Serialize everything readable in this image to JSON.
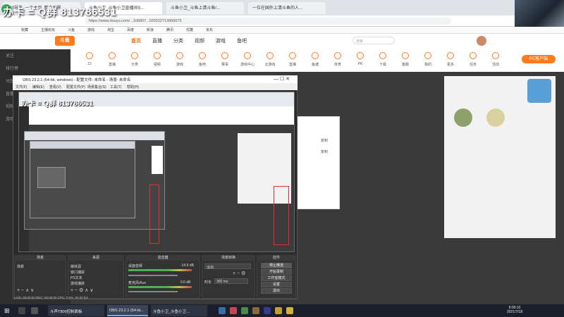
{
  "overlay": {
    "text": "办卡 = Q群 813786531",
    "small_text": "办卡 = Q群 813786531"
  },
  "browser": {
    "tabs": [
      "360导航_一个主页, 整个世界",
      "斗鱼小卫_斗鱼小卫直播间S...",
      "斗鱼小卫_斗鱼上清斗鱼/...",
      "一位在国外上清斗鱼的人..."
    ],
    "url": "https://www.douyu.com/...106807...020222713966073",
    "bookmarks": [
      "收藏",
      "主播玩玩",
      "斗鱼",
      "游戏",
      "淘宝",
      "百度",
      "新浪",
      "腾讯",
      "优酷",
      "京东"
    ]
  },
  "site": {
    "logo": "斗鱼",
    "nav": [
      "首页",
      "直播",
      "分类",
      "视频",
      "游戏",
      "鱼吧"
    ],
    "search_placeholder": "搜索",
    "vip_button": "PC客户端",
    "left_nav": [
      "关注",
      "排行榜",
      "分区",
      "直播",
      "视频",
      "游戏"
    ],
    "categories": [
      "12",
      "直播",
      "分类",
      "视频",
      "游戏",
      "鱼吧",
      "赛事",
      "游戏中心",
      "云游戏",
      "直播",
      "鱼塘",
      "体育",
      "PK",
      "下载",
      "客服",
      "我的",
      "更多",
      "任务",
      "活动"
    ],
    "popup_labels": [
      "复制",
      "复制"
    ]
  },
  "obs": {
    "title": "OBS 23.2.1 (64-bit, windows) - 配置文件: 未命名 - 场景: 未命名",
    "menu": [
      "文件(F)",
      "编辑(E)",
      "查看(V)",
      "配置文件(P)",
      "场景集合(S)",
      "工具(T)",
      "帮助(H)"
    ],
    "docks": {
      "scenes_title": "场景",
      "scenes": [
        "场景"
      ],
      "sources_title": "来源",
      "sources": [
        "媒体源",
        "窗口捕获",
        "PS文本",
        "游戏捕获"
      ],
      "mixer_title": "混音器",
      "mixer": [
        {
          "name": "桌面音频",
          "db": "-14.9 dB"
        },
        {
          "name": "麦克风/Aux",
          "db": "0.0 dB"
        }
      ],
      "transitions_title": "场景转换",
      "transition": "淡出",
      "duration_label": "时长",
      "duration": "300 ms",
      "controls_title": "控件",
      "controls": [
        "停止推流",
        "开始录制",
        "工作室模式",
        "设置",
        "退出"
      ]
    },
    "status": "LIVE: 00:00:00    REC: 00:00:00    CPU: 2.5%, 60.00 fps"
  },
  "taskbar": {
    "tasks": [
      "斗声T800控制面板",
      "OBS 23.2.1 (64-bi...",
      "斗鱼小卫_斗鱼小卫..."
    ],
    "time": "9:00:10",
    "date": "2021/7/18"
  },
  "colors": {
    "accent": "#ff7a1a",
    "obs_bg": "#2a2a2a"
  }
}
